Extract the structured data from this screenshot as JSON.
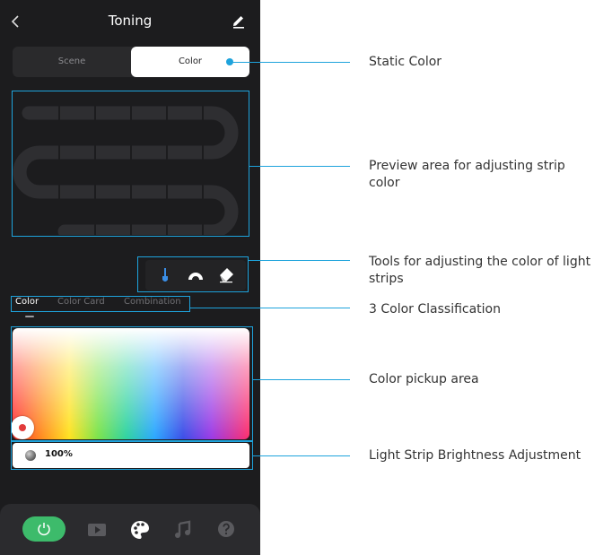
{
  "header": {
    "title": "Toning",
    "back_icon": "chevron-left-icon",
    "edit_icon": "pencil-icon"
  },
  "mode_switch": {
    "options": [
      "Scene",
      "Color"
    ],
    "selected": "Color"
  },
  "tools": [
    "brush-icon",
    "arc-icon",
    "eraser-icon"
  ],
  "color_tabs": {
    "items": [
      "Color",
      "Color Card",
      "Combination"
    ],
    "selected": "Color"
  },
  "picker": {
    "selected_color": "#e23b3b"
  },
  "brightness": {
    "value": "100%"
  },
  "tabbar": {
    "items": [
      "power-icon",
      "video-icon",
      "palette-icon",
      "music-icon",
      "help-icon"
    ],
    "active": "power-icon",
    "active_color": "#3dbb6b"
  },
  "annotations": {
    "static_color": "Static Color",
    "preview_area": "Preview area for adjusting strip color",
    "tools": "Tools for adjusting the color of light strips",
    "classification": "3 Color Classification",
    "pickup_area": "Color pickup area",
    "brightness": "Light Strip Brightness Adjustment"
  },
  "colors": {
    "accent": "#1ea3dc",
    "panel_bg": "#1c1c1e"
  }
}
